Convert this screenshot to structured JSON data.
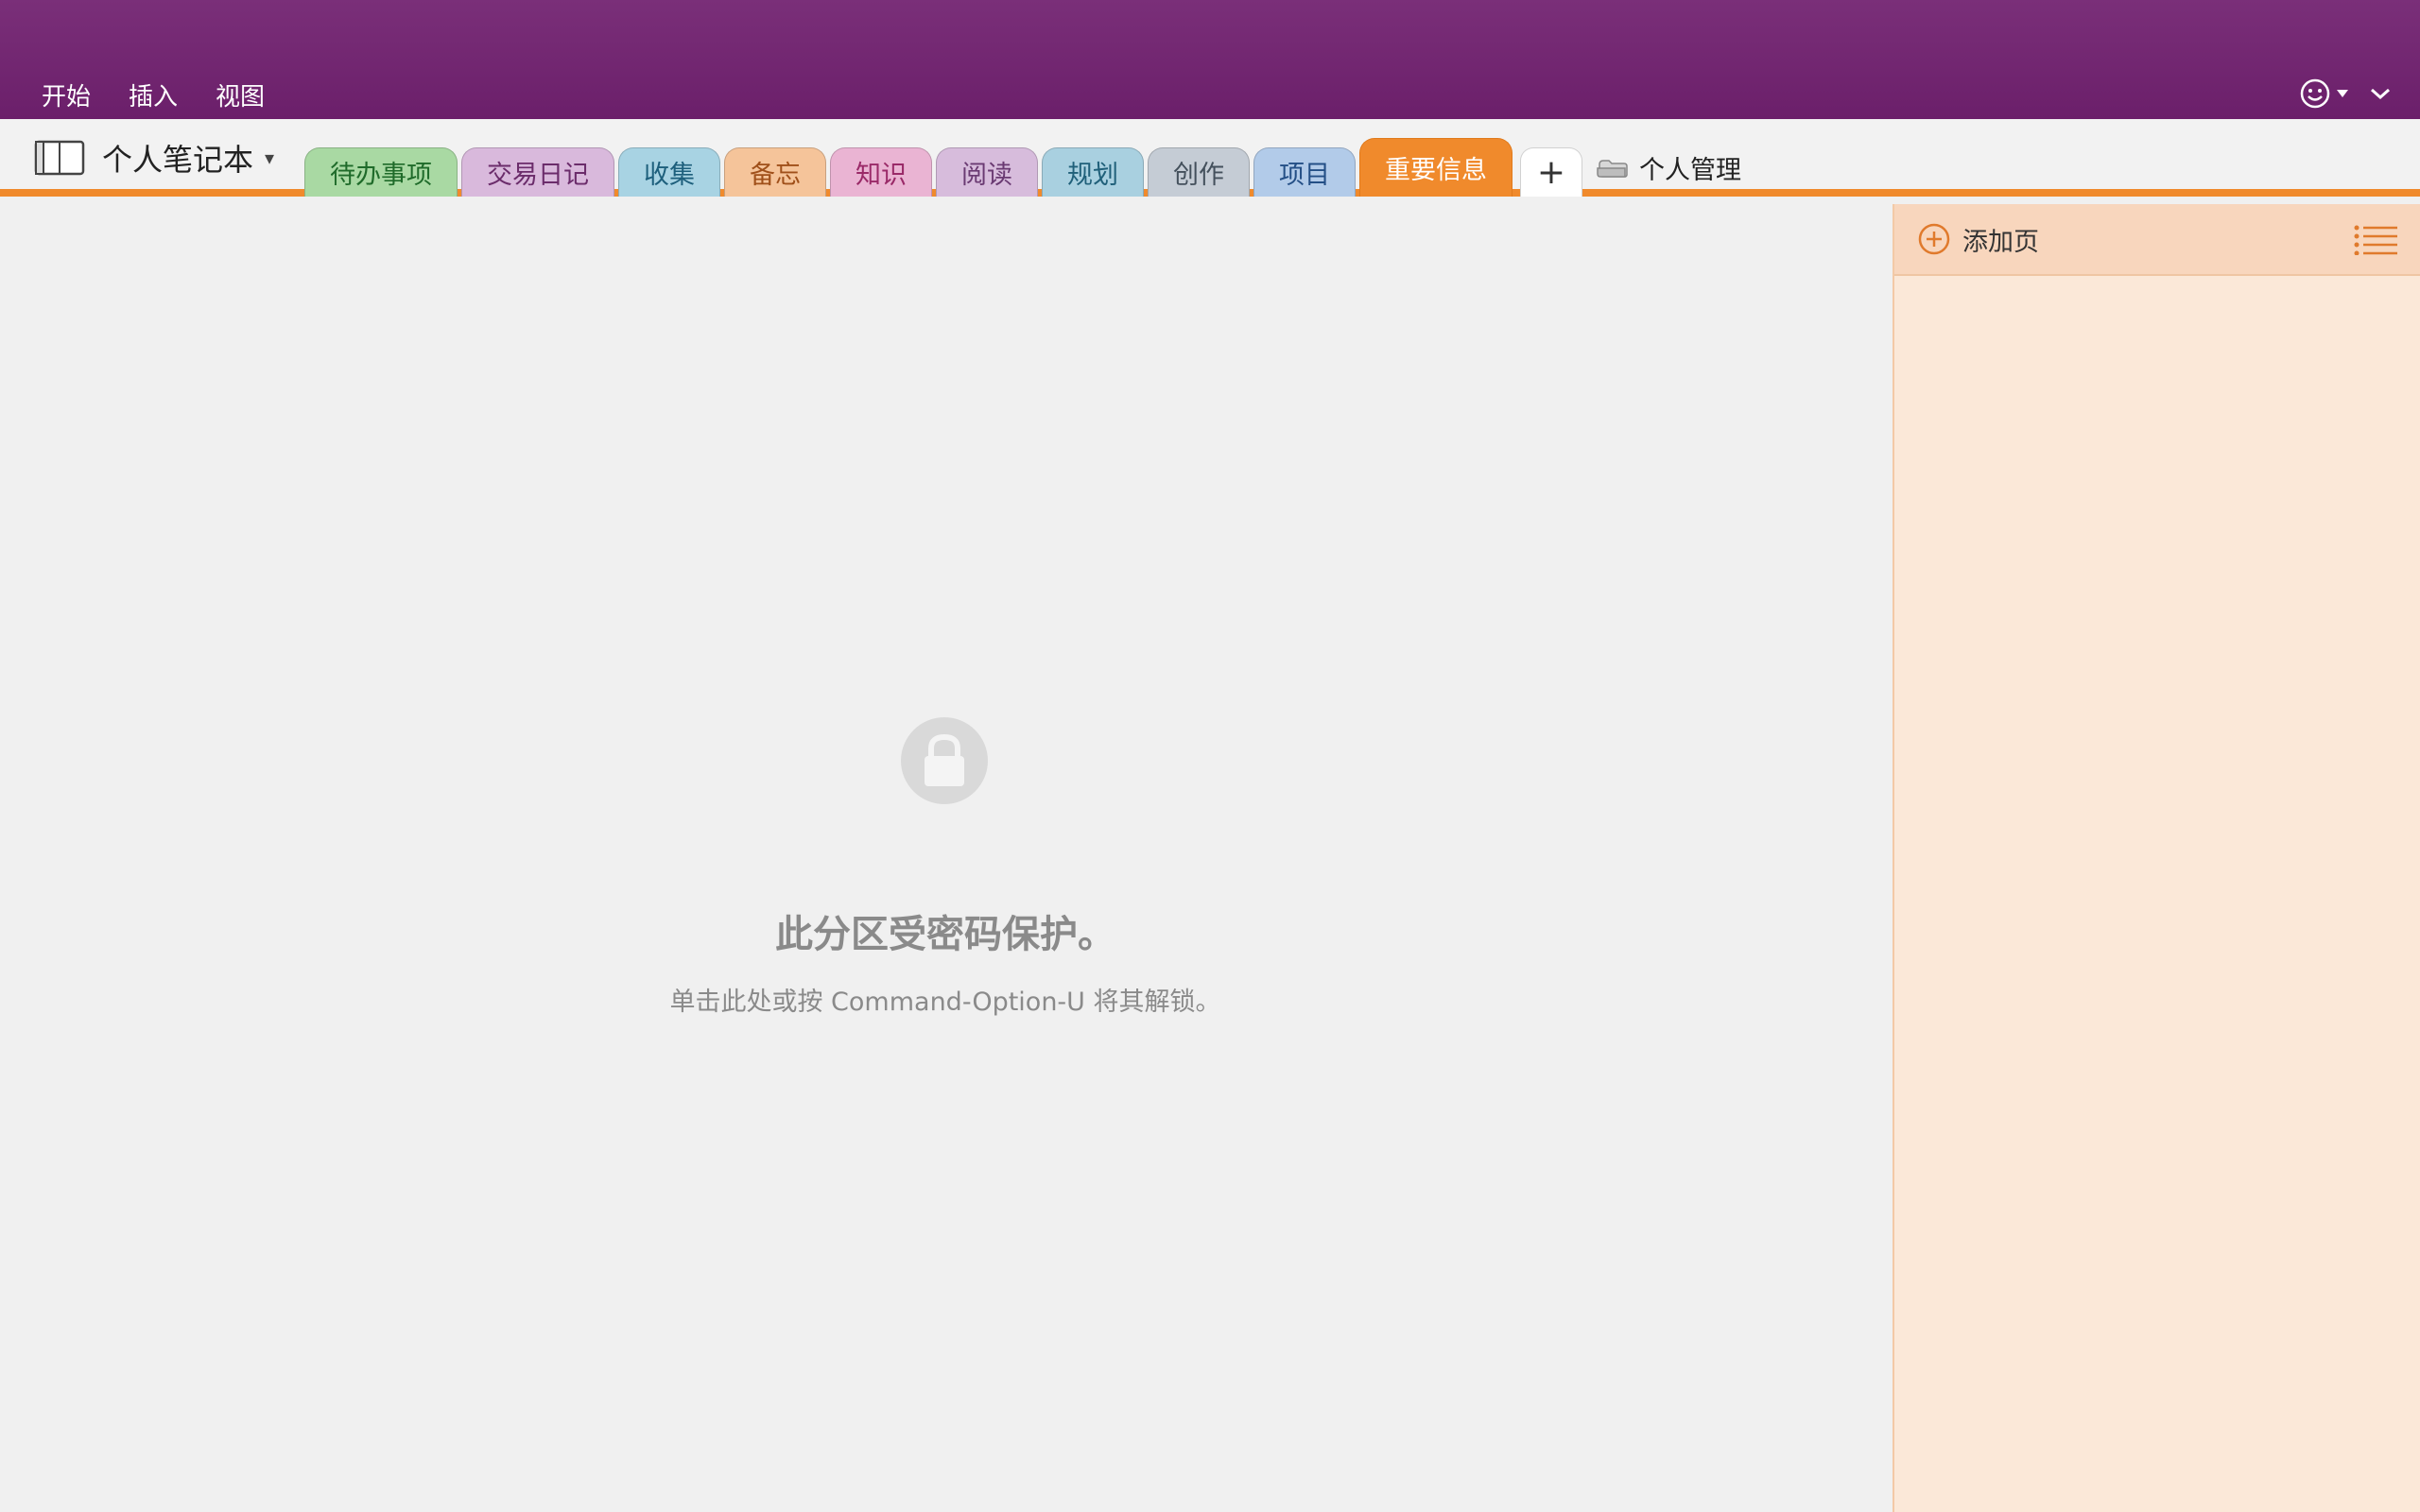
{
  "ribbon": {
    "tabs": [
      "开始",
      "插入",
      "视图"
    ]
  },
  "notebook": {
    "title": "个人笔记本",
    "caret": "▾"
  },
  "sections": [
    {
      "label": "待办事项",
      "bg": "#a9d9a3",
      "fg": "#1f6b2a"
    },
    {
      "label": "交易日记",
      "bg": "#d9b9dc",
      "fg": "#6b2c6b"
    },
    {
      "label": "收集",
      "bg": "#a8d3e3",
      "fg": "#1d5f7c"
    },
    {
      "label": "备忘",
      "bg": "#f5c49a",
      "fg": "#a0501a"
    },
    {
      "label": "知识",
      "bg": "#eab4d3",
      "fg": "#9a2a68"
    },
    {
      "label": "阅读",
      "bg": "#d7bcdc",
      "fg": "#6a3a72"
    },
    {
      "label": "规划",
      "bg": "#a9d0e0",
      "fg": "#20607a"
    },
    {
      "label": "创作",
      "bg": "#c5ccd5",
      "fg": "#44505c"
    },
    {
      "label": "项目",
      "bg": "#b2cbe9",
      "fg": "#244f86"
    },
    {
      "label": "重要信息",
      "bg": "#f08a2c",
      "fg": "#ffffff",
      "active": true
    }
  ],
  "add_section": "+",
  "section_group": {
    "label": "个人管理"
  },
  "locked": {
    "title": "此分区受密码保护。",
    "hint": "单击此处或按 Command-Option-U 将其解锁。"
  },
  "page_pane": {
    "add_page": "添加页"
  },
  "colors": {
    "title_bar": "#6b1f6a",
    "accent": "#f08a2c",
    "page_pane_bg": "#fbe8d8"
  }
}
